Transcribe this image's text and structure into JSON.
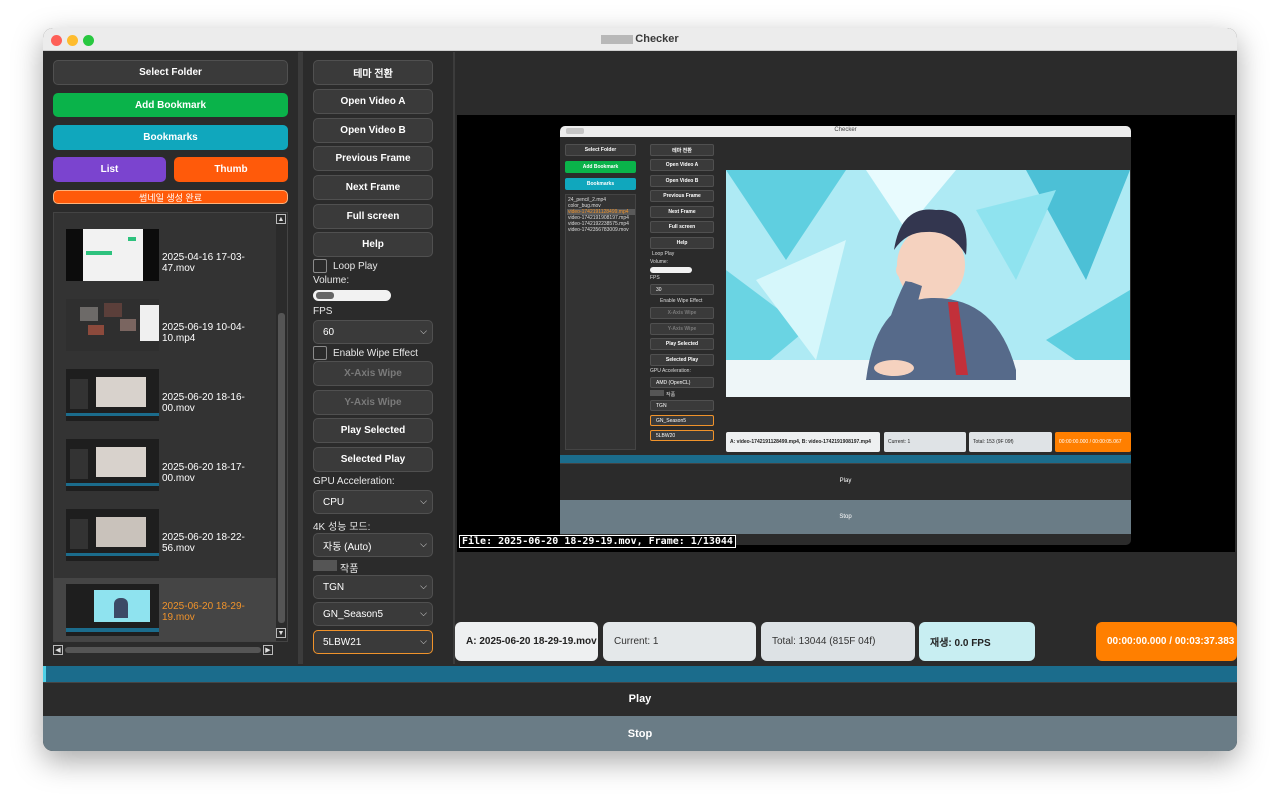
{
  "window": {
    "title": "Checker"
  },
  "left": {
    "select_folder": "Select Folder",
    "add_bookmark": "Add Bookmark",
    "bookmarks": "Bookmarks",
    "list": "List",
    "thumb": "Thumb",
    "thumb_status": "썸네일 생성 완료",
    "items": [
      {
        "name": "2025-04-16 17-03-47.mov"
      },
      {
        "name": "2025-06-19 10-04-10.mp4"
      },
      {
        "name": "2025-06-20 18-16-00.mov"
      },
      {
        "name": "2025-06-20 18-17-00.mov"
      },
      {
        "name": "2025-06-20 18-22-56.mov"
      },
      {
        "name": "2025-06-20 18-29-19.mov"
      }
    ]
  },
  "mid": {
    "theme": "테마 전환",
    "open_a": "Open Video A",
    "open_b": "Open Video B",
    "prev_frame": "Previous Frame",
    "next_frame": "Next Frame",
    "full_screen": "Full screen",
    "help": "Help",
    "loop_play": "Loop Play",
    "volume_label": "Volume:",
    "volume_level": 0.25,
    "fps_label": "FPS",
    "fps_value": "60",
    "wipe_label": "Enable Wipe Effect",
    "x_wipe": "X-Axis Wipe",
    "y_wipe": "Y-Axis Wipe",
    "play_selected": "Play Selected",
    "selected_play": "Selected Play",
    "gpu_label": "GPU Acceleration:",
    "gpu_value": "CPU",
    "perf_label": "4K 성능 모드:",
    "perf_value": "자동 (Auto)",
    "works_label": "작품",
    "works_value": "TGN",
    "season_value": "GN_Season5",
    "lbw_value": "5LBW21"
  },
  "viewer": {
    "overlay": "File: 2025-06-20 18-29-19.mov, Frame: 1/13044",
    "inner": {
      "title": "Checker",
      "select_folder": "Select Folder",
      "add_bookmark": "Add Bookmark",
      "bookmarks": "Bookmarks",
      "files": [
        "24_pencil_2.mp4",
        "color_bug.mov",
        "video-1742191128499.mp4",
        "video-1742191908197.mp4",
        "video-1742192238575.mp4",
        "video-1742356783009.mov"
      ],
      "theme": "테마 전환",
      "open_a": "Open Video A",
      "open_b": "Open Video B",
      "prev": "Previous Frame",
      "next": "Next Frame",
      "full": "Full screen",
      "help": "Help",
      "loop": "Loop Play",
      "volume": "Volume:",
      "fps": "FPS",
      "fps_value": "30",
      "wipe": "Enable Wipe Effect",
      "x_wipe": "X-Axis Wipe",
      "y_wipe": "Y-Axis Wipe",
      "play_selected": "Play Selected",
      "selected_play": "Selected Play",
      "gpu": "GPU Acceleration:",
      "gpu_value": "AMD (OpenCL)",
      "works": "작품",
      "works_value": "TGN",
      "season": "GN_Season5",
      "lbw": "5LBW20",
      "status_a": "A: video-1742191128499.mp4, B: video-1742191908197.mp4",
      "status_current": "Current: 1",
      "status_total": "Total: 153 (9F 09f)",
      "status_time": "00:00:00.000 / 00:00:05.067",
      "play": "Play",
      "stop": "Stop"
    }
  },
  "status": {
    "file": "A: 2025-06-20 18-29-19.mov",
    "current": "Current: 1",
    "total": "Total: 13044 (815F 04f)",
    "playback": "재생: 0.0 FPS",
    "time": "00:00:00.000 / 00:03:37.383"
  },
  "bottom": {
    "play": "Play",
    "stop": "Stop"
  },
  "colors": {
    "green": "#0ab34a",
    "teal": "#10a7bd",
    "purple": "#7b44cf",
    "orange": "#ff5a0a",
    "selected_text": "#f0932b",
    "timeline": "#1b6c8c"
  }
}
